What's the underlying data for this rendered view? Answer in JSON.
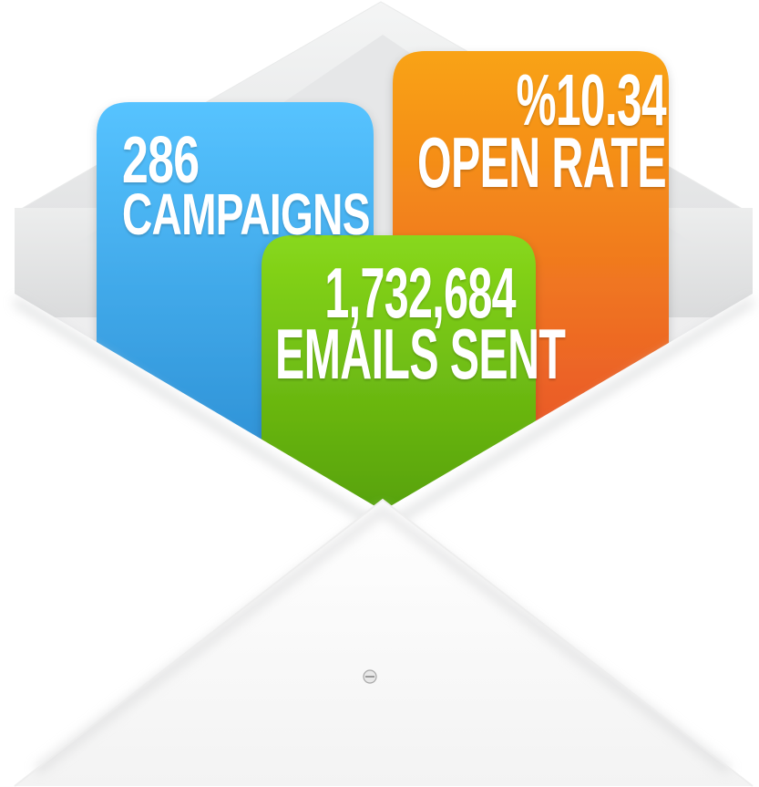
{
  "stats": {
    "campaigns": {
      "value": "286",
      "label": "CAMPAIGNS",
      "color_top": "#55c0fb",
      "color_bottom": "#2a8fd6"
    },
    "open_rate": {
      "value": "%10.34",
      "label": "OPEN RATE",
      "color_top": "#f89a12",
      "color_bottom": "#e8542b"
    },
    "emails_sent": {
      "value": "1,732,684",
      "label": "EMAILS SENT",
      "color_top": "#86d51a",
      "color_bottom": "#4f9a08"
    }
  },
  "envelope": {
    "color": "#ffffff",
    "shadow": "#d9dadb"
  }
}
